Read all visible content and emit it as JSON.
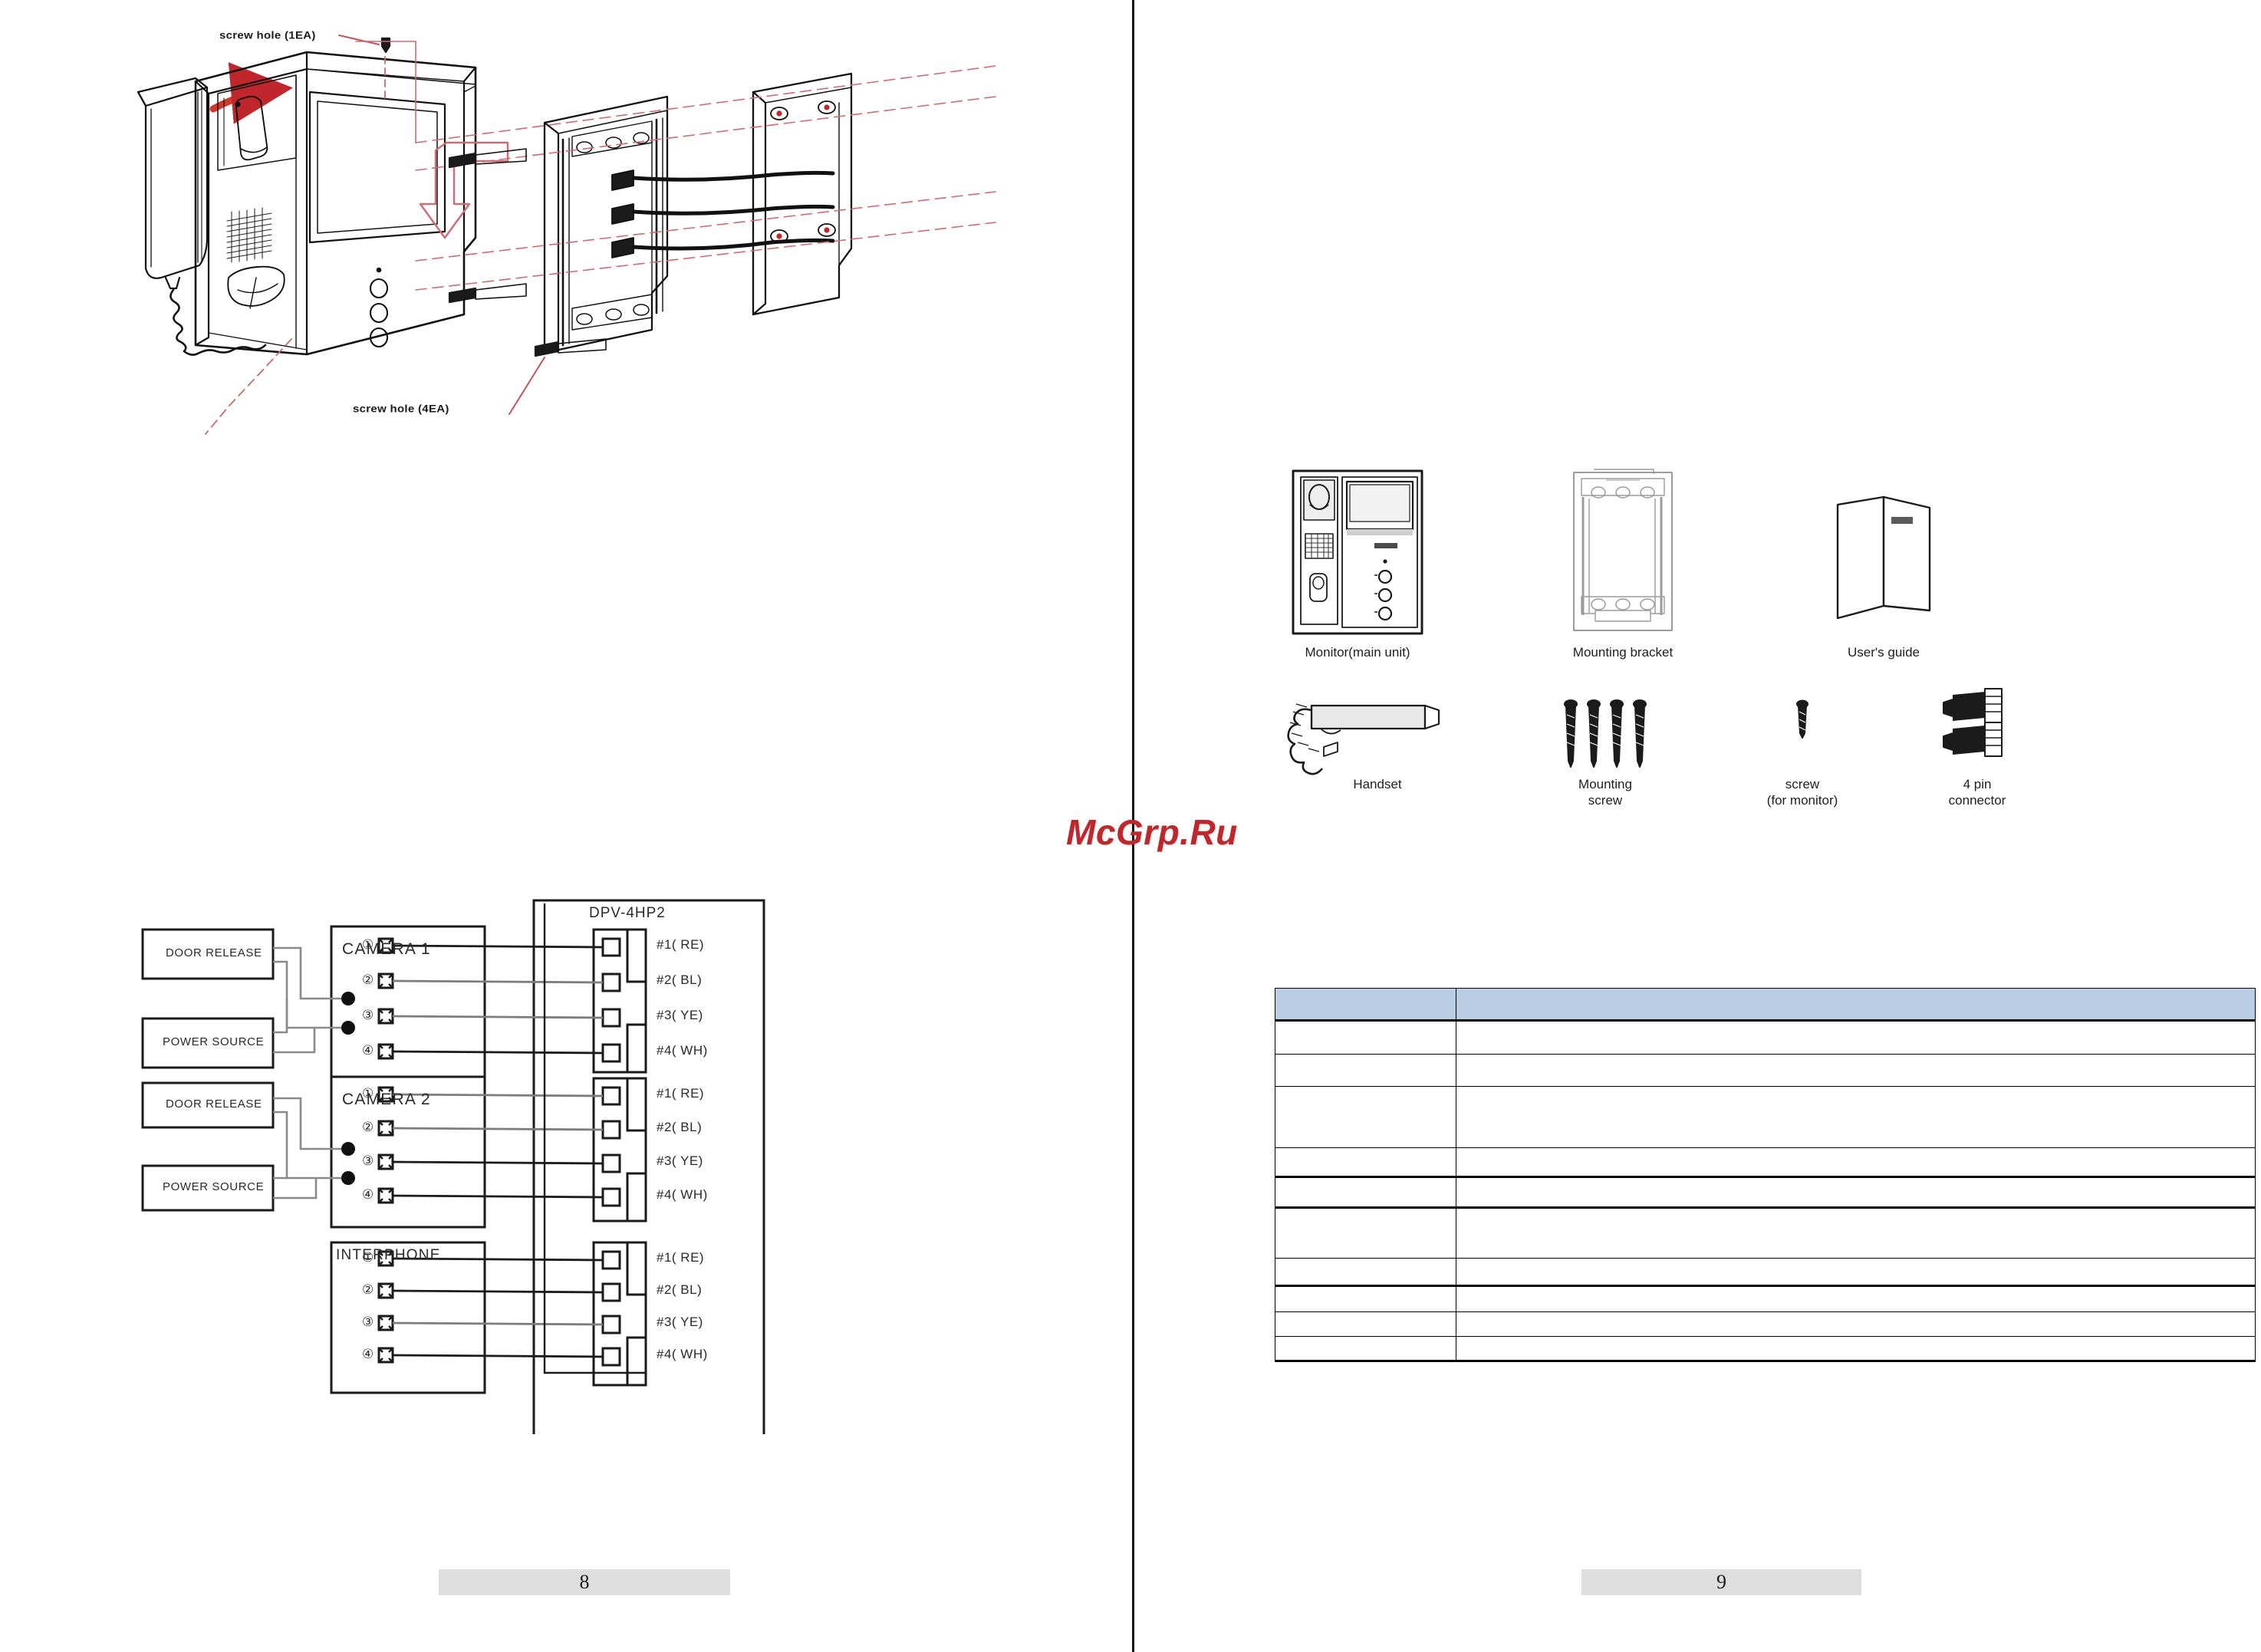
{
  "document": {
    "type": "video-intercom-user-manual-spread",
    "model": "DPV-4HP2",
    "watermark": "McGrp.Ru"
  },
  "pages": {
    "left": {
      "number": "8"
    },
    "right": {
      "number": "9"
    }
  },
  "exploded_diagram": {
    "name": "monitor-wall-mount-installation",
    "labels": [
      {
        "id": "screw-hole-1ea",
        "text": "screw hole (1EA)"
      },
      {
        "id": "screw-hole-4ea",
        "text": "screw hole (4EA)"
      }
    ],
    "parts_depicted": [
      "handset",
      "monitor-main-unit",
      "mounting-bracket",
      "wall-box",
      "mounting-screws"
    ]
  },
  "wiring_diagram": {
    "title": "DPV-4HP2",
    "source_blocks": [
      {
        "id": "door-release-1",
        "label": "DOOR RELEASE"
      },
      {
        "id": "power-source-1",
        "label": "POWER SOURCE"
      },
      {
        "id": "door-release-2",
        "label": "DOOR RELEASE"
      },
      {
        "id": "power-source-2",
        "label": "POWER SOURCE"
      }
    ],
    "devices": [
      {
        "id": "camera-1",
        "label": "CAMERA 1",
        "terminals": [
          "①",
          "②",
          "③",
          "④"
        ]
      },
      {
        "id": "camera-2",
        "label": "CAMERA 2",
        "terminals": [
          "①",
          "②",
          "③",
          "④"
        ]
      },
      {
        "id": "interphone",
        "label": "INTERPHONE",
        "terminals": [
          "①",
          "②",
          "③",
          "④"
        ]
      }
    ],
    "connector_groups": [
      {
        "id": "connector-camera-1",
        "pins": [
          "#1( RE)",
          "#2( BL)",
          "#3( YE)",
          "#4( WH)"
        ]
      },
      {
        "id": "connector-camera-2",
        "pins": [
          "#1( RE)",
          "#2( BL)",
          "#3( YE)",
          "#4( WH)"
        ]
      },
      {
        "id": "connector-interphone",
        "pins": [
          "#1( RE)",
          "#2( BL)",
          "#3( YE)",
          "#4( WH)"
        ]
      }
    ],
    "wire_color_legend": [
      {
        "pin": "#1",
        "code": "RE",
        "color": "#d43b2f"
      },
      {
        "pin": "#2",
        "code": "BL",
        "color": "#2a4fa8"
      },
      {
        "pin": "#3",
        "code": "YE",
        "color": "#e0c423"
      },
      {
        "pin": "#4",
        "code": "WH",
        "color": "#ffffff"
      }
    ]
  },
  "parts_list": {
    "row1": [
      {
        "id": "monitor-main-unit",
        "caption": "Monitor(main unit)"
      },
      {
        "id": "mounting-bracket",
        "caption": "Mounting bracket"
      },
      {
        "id": "users-guide",
        "caption": "User's guide"
      }
    ],
    "row2": [
      {
        "id": "handset",
        "caption": "Handset"
      },
      {
        "id": "mounting-screw",
        "caption": "Mounting\nscrew"
      },
      {
        "id": "screw-for-monitor",
        "caption": "screw\n(for monitor)"
      },
      {
        "id": "four-pin-connector",
        "caption": "4 pin\nconnector"
      }
    ]
  },
  "spec_table": {
    "header_color": "#b8cce4",
    "columns": 2,
    "header_row": [
      "",
      ""
    ],
    "rows": [
      [
        "",
        ""
      ],
      [
        "",
        ""
      ],
      [
        "",
        ""
      ],
      [
        "",
        ""
      ],
      [
        "",
        ""
      ],
      [
        "",
        ""
      ],
      [
        "",
        ""
      ],
      [
        "",
        ""
      ],
      [
        "",
        ""
      ],
      [
        "",
        ""
      ]
    ]
  }
}
